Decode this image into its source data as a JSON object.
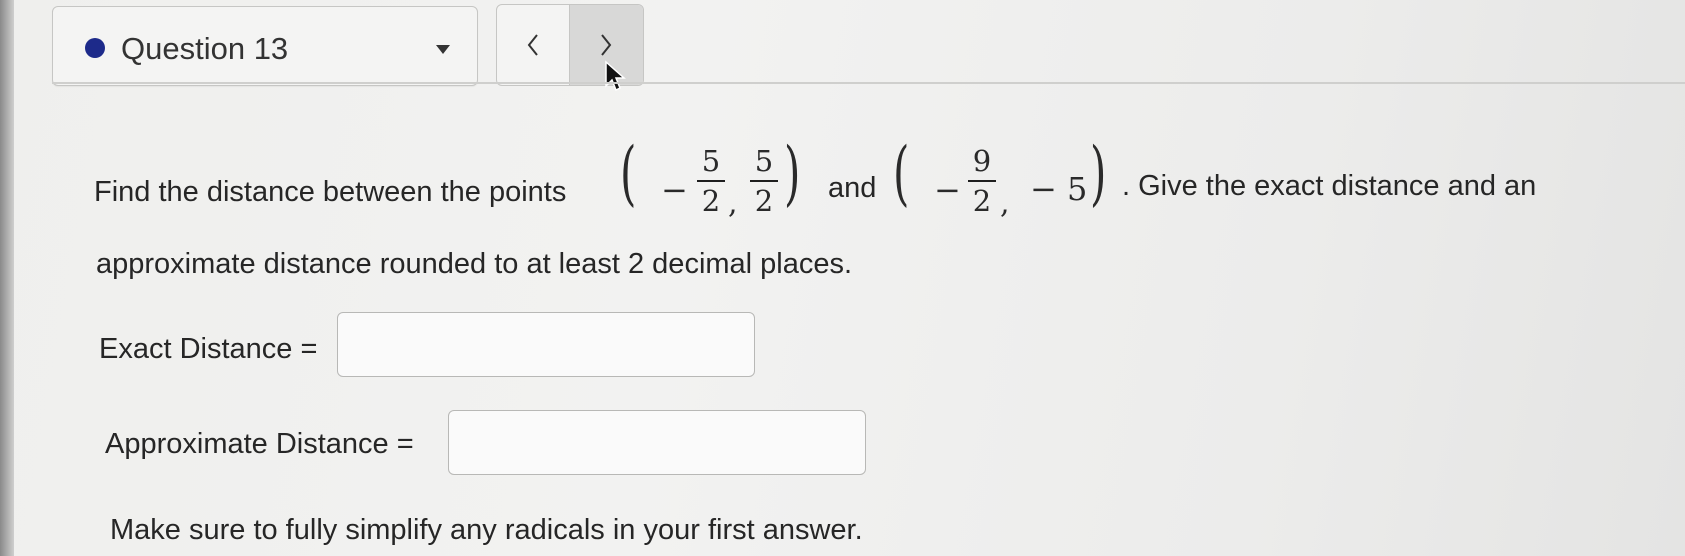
{
  "header": {
    "question_label": "Question 13",
    "prev_label": "<",
    "next_label": ">"
  },
  "question": {
    "text_before_point1": "Find the distance between the points",
    "point1": {
      "x_sign": "−",
      "x_num": "5",
      "x_den": "2",
      "y_num": "5",
      "y_den": "2"
    },
    "and_text": "and",
    "point2": {
      "x_sign": "−",
      "x_num": "9",
      "x_den": "2",
      "y_value": "− 5"
    },
    "text_after_point2": ". Give the exact distance and an",
    "line2": "approximate distance rounded to at least 2 decimal places."
  },
  "fields": {
    "exact_label": "Exact Distance =",
    "exact_value": "",
    "approx_label": "Approximate Distance =",
    "approx_value": ""
  },
  "note": "Make sure to fully simplify any radicals in your first answer.",
  "colors": {
    "status_dot": "#1d2a8a",
    "next_bg": "#d8d8d7"
  },
  "icons": [
    "status-dot-icon",
    "dropdown-caret-icon",
    "chevron-left-icon",
    "chevron-right-icon",
    "mouse-cursor-icon"
  ]
}
